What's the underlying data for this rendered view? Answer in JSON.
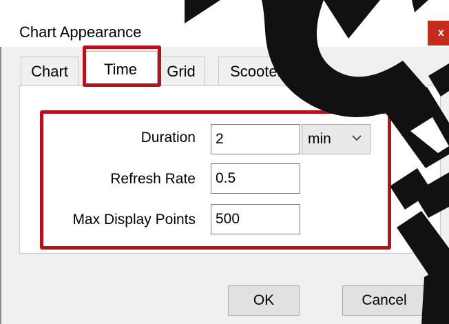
{
  "window": {
    "title": "Chart Appearance",
    "close_glyph": "x"
  },
  "tabs": [
    {
      "label": "Chart",
      "selected": false
    },
    {
      "label": "Time",
      "selected": true
    },
    {
      "label": "Grid",
      "selected": false
    },
    {
      "label": "Scooter",
      "selected": false
    }
  ],
  "form": {
    "duration": {
      "label": "Duration",
      "value": "2",
      "unit": "min"
    },
    "refresh_rate": {
      "label": "Refresh Rate",
      "value": "0.5"
    },
    "max_display_points": {
      "label": "Max Display Points",
      "value": "500"
    }
  },
  "buttons": {
    "ok": "OK",
    "cancel": "Cancel"
  },
  "colors": {
    "highlight": "#b5121b",
    "watermark": "#111111",
    "close_button": "#c42b1c"
  },
  "icons": {
    "dropdown": "chevron-down-icon"
  }
}
